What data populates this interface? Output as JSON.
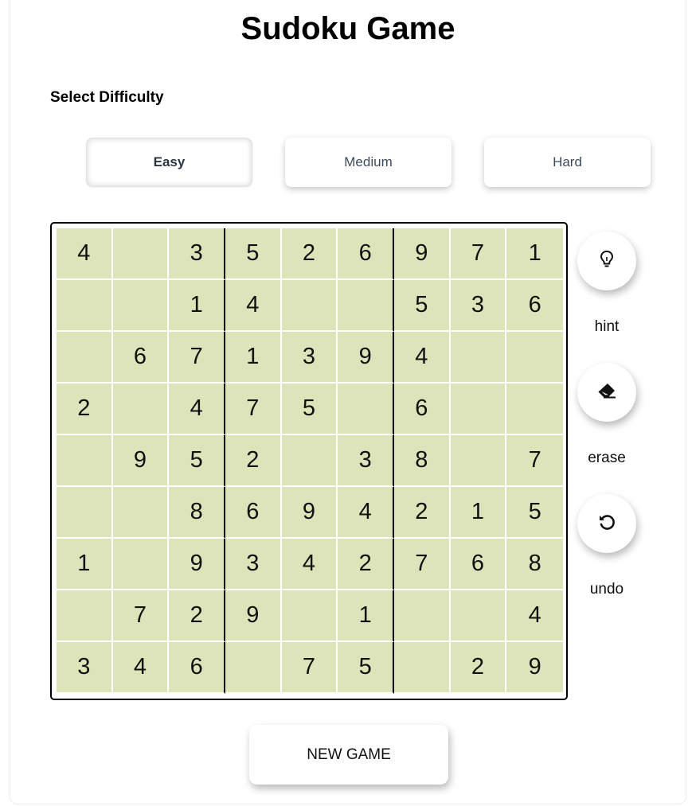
{
  "title": "Sudoku Game",
  "difficulty": {
    "label": "Select Difficulty",
    "options": [
      "Easy",
      "Medium",
      "Hard"
    ],
    "selected": "Easy"
  },
  "board": [
    [
      "4",
      "",
      "3",
      "5",
      "2",
      "6",
      "9",
      "7",
      "1"
    ],
    [
      "",
      "",
      "1",
      "4",
      "",
      "",
      "5",
      "3",
      "6"
    ],
    [
      "",
      "6",
      "7",
      "1",
      "3",
      "9",
      "4",
      "",
      ""
    ],
    [
      "2",
      "",
      "4",
      "7",
      "5",
      "",
      "6",
      "",
      ""
    ],
    [
      "",
      "9",
      "5",
      "2",
      "",
      "3",
      "8",
      "",
      "7"
    ],
    [
      "",
      "",
      "8",
      "6",
      "9",
      "4",
      "2",
      "1",
      "5"
    ],
    [
      "1",
      "",
      "9",
      "3",
      "4",
      "2",
      "7",
      "6",
      "8"
    ],
    [
      "",
      "7",
      "2",
      "9",
      "",
      "1",
      "",
      "",
      "4"
    ],
    [
      "3",
      "4",
      "6",
      "",
      "7",
      "5",
      "",
      "2",
      "9"
    ]
  ],
  "tools": [
    {
      "label": "hint",
      "icon": "lightbulb-icon"
    },
    {
      "label": "erase",
      "icon": "eraser-icon"
    },
    {
      "label": "undo",
      "icon": "undo-icon"
    }
  ],
  "new_game_label": "NEW GAME",
  "colors": {
    "cell_background": "#dde4b9",
    "cell_divider": "#ffffff",
    "box_divider": "#000000"
  }
}
